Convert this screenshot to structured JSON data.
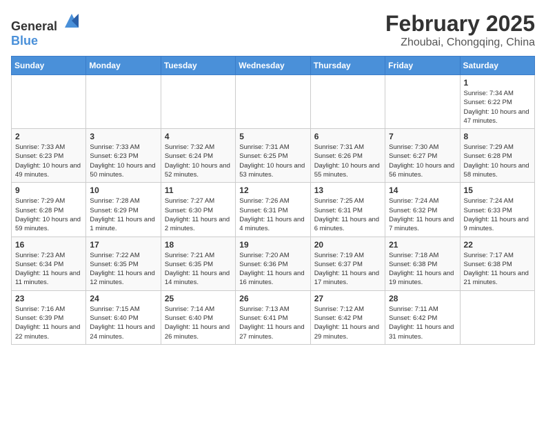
{
  "header": {
    "logo_general": "General",
    "logo_blue": "Blue",
    "title": "February 2025",
    "location": "Zhoubai, Chongqing, China"
  },
  "calendar": {
    "days_of_week": [
      "Sunday",
      "Monday",
      "Tuesday",
      "Wednesday",
      "Thursday",
      "Friday",
      "Saturday"
    ],
    "weeks": [
      [
        {
          "day": "",
          "info": ""
        },
        {
          "day": "",
          "info": ""
        },
        {
          "day": "",
          "info": ""
        },
        {
          "day": "",
          "info": ""
        },
        {
          "day": "",
          "info": ""
        },
        {
          "day": "",
          "info": ""
        },
        {
          "day": "1",
          "info": "Sunrise: 7:34 AM\nSunset: 6:22 PM\nDaylight: 10 hours and 47 minutes."
        }
      ],
      [
        {
          "day": "2",
          "info": "Sunrise: 7:33 AM\nSunset: 6:23 PM\nDaylight: 10 hours and 49 minutes."
        },
        {
          "day": "3",
          "info": "Sunrise: 7:33 AM\nSunset: 6:23 PM\nDaylight: 10 hours and 50 minutes."
        },
        {
          "day": "4",
          "info": "Sunrise: 7:32 AM\nSunset: 6:24 PM\nDaylight: 10 hours and 52 minutes."
        },
        {
          "day": "5",
          "info": "Sunrise: 7:31 AM\nSunset: 6:25 PM\nDaylight: 10 hours and 53 minutes."
        },
        {
          "day": "6",
          "info": "Sunrise: 7:31 AM\nSunset: 6:26 PM\nDaylight: 10 hours and 55 minutes."
        },
        {
          "day": "7",
          "info": "Sunrise: 7:30 AM\nSunset: 6:27 PM\nDaylight: 10 hours and 56 minutes."
        },
        {
          "day": "8",
          "info": "Sunrise: 7:29 AM\nSunset: 6:28 PM\nDaylight: 10 hours and 58 minutes."
        }
      ],
      [
        {
          "day": "9",
          "info": "Sunrise: 7:29 AM\nSunset: 6:28 PM\nDaylight: 10 hours and 59 minutes."
        },
        {
          "day": "10",
          "info": "Sunrise: 7:28 AM\nSunset: 6:29 PM\nDaylight: 11 hours and 1 minute."
        },
        {
          "day": "11",
          "info": "Sunrise: 7:27 AM\nSunset: 6:30 PM\nDaylight: 11 hours and 2 minutes."
        },
        {
          "day": "12",
          "info": "Sunrise: 7:26 AM\nSunset: 6:31 PM\nDaylight: 11 hours and 4 minutes."
        },
        {
          "day": "13",
          "info": "Sunrise: 7:25 AM\nSunset: 6:31 PM\nDaylight: 11 hours and 6 minutes."
        },
        {
          "day": "14",
          "info": "Sunrise: 7:24 AM\nSunset: 6:32 PM\nDaylight: 11 hours and 7 minutes."
        },
        {
          "day": "15",
          "info": "Sunrise: 7:24 AM\nSunset: 6:33 PM\nDaylight: 11 hours and 9 minutes."
        }
      ],
      [
        {
          "day": "16",
          "info": "Sunrise: 7:23 AM\nSunset: 6:34 PM\nDaylight: 11 hours and 11 minutes."
        },
        {
          "day": "17",
          "info": "Sunrise: 7:22 AM\nSunset: 6:35 PM\nDaylight: 11 hours and 12 minutes."
        },
        {
          "day": "18",
          "info": "Sunrise: 7:21 AM\nSunset: 6:35 PM\nDaylight: 11 hours and 14 minutes."
        },
        {
          "day": "19",
          "info": "Sunrise: 7:20 AM\nSunset: 6:36 PM\nDaylight: 11 hours and 16 minutes."
        },
        {
          "day": "20",
          "info": "Sunrise: 7:19 AM\nSunset: 6:37 PM\nDaylight: 11 hours and 17 minutes."
        },
        {
          "day": "21",
          "info": "Sunrise: 7:18 AM\nSunset: 6:38 PM\nDaylight: 11 hours and 19 minutes."
        },
        {
          "day": "22",
          "info": "Sunrise: 7:17 AM\nSunset: 6:38 PM\nDaylight: 11 hours and 21 minutes."
        }
      ],
      [
        {
          "day": "23",
          "info": "Sunrise: 7:16 AM\nSunset: 6:39 PM\nDaylight: 11 hours and 22 minutes."
        },
        {
          "day": "24",
          "info": "Sunrise: 7:15 AM\nSunset: 6:40 PM\nDaylight: 11 hours and 24 minutes."
        },
        {
          "day": "25",
          "info": "Sunrise: 7:14 AM\nSunset: 6:40 PM\nDaylight: 11 hours and 26 minutes."
        },
        {
          "day": "26",
          "info": "Sunrise: 7:13 AM\nSunset: 6:41 PM\nDaylight: 11 hours and 27 minutes."
        },
        {
          "day": "27",
          "info": "Sunrise: 7:12 AM\nSunset: 6:42 PM\nDaylight: 11 hours and 29 minutes."
        },
        {
          "day": "28",
          "info": "Sunrise: 7:11 AM\nSunset: 6:42 PM\nDaylight: 11 hours and 31 minutes."
        },
        {
          "day": "",
          "info": ""
        }
      ]
    ]
  }
}
